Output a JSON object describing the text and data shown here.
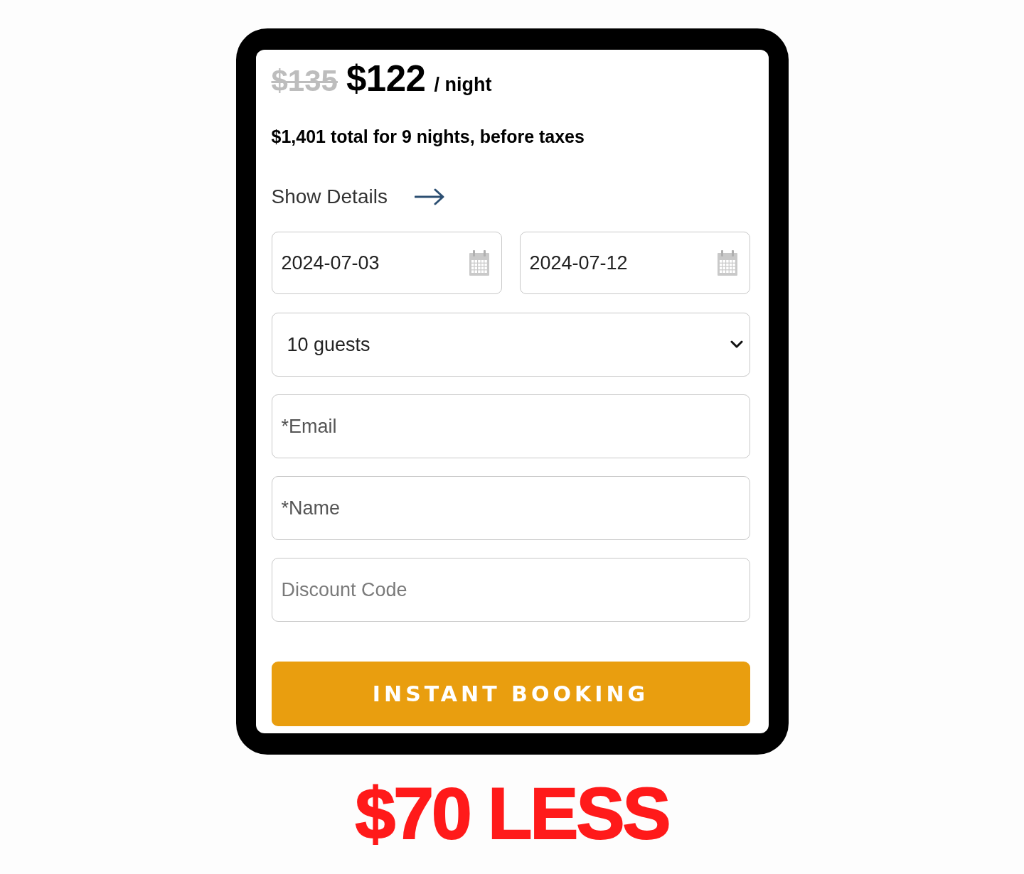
{
  "listing": {
    "original_price": "$135",
    "price": "$122",
    "unit": "/ night",
    "total": "$1,401 total for 9 nights, before taxes",
    "details_link": "Show Details"
  },
  "form": {
    "dates": [
      {
        "value": "2024-07-03"
      },
      {
        "value": "2024-07-12"
      }
    ],
    "guests": {
      "value": "10 guests"
    },
    "fields": [
      {
        "placeholder": "*Email",
        "required": true
      },
      {
        "placeholder": "*Name",
        "required": true
      },
      {
        "placeholder": "Discount Code",
        "required": false
      }
    ],
    "submit": "INSTANT BOOKING"
  },
  "caption": "$70 LESS"
}
